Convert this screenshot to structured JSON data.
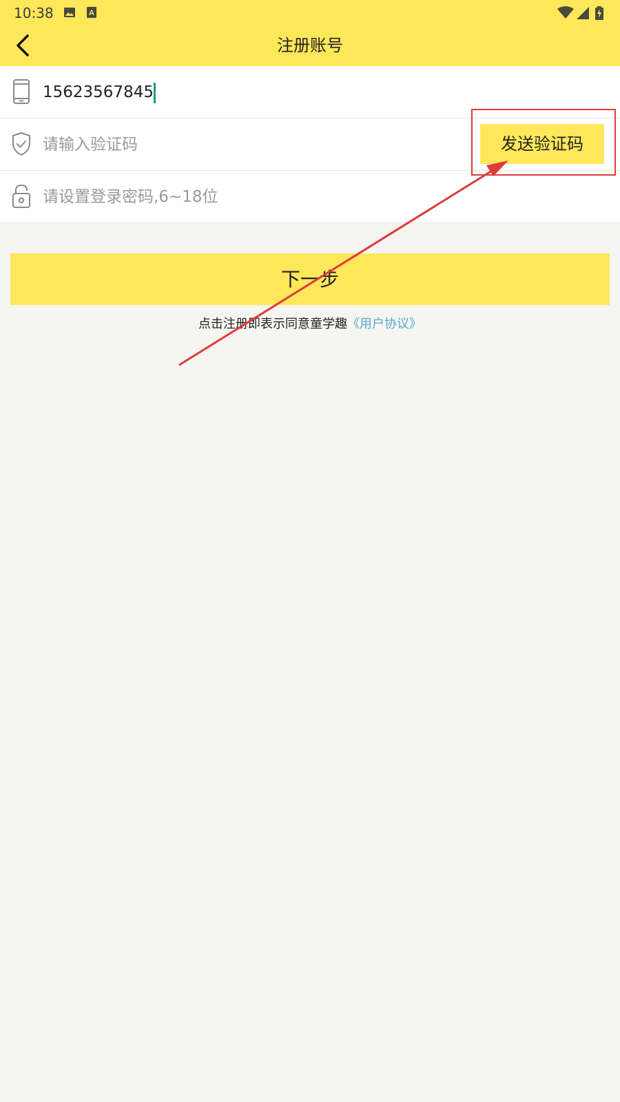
{
  "status_bar": {
    "time": "10:38",
    "icons": [
      "image-icon",
      "text-a-icon",
      "wifi-icon",
      "signal-icon",
      "battery-charging-icon"
    ]
  },
  "header": {
    "title": "注册账号",
    "back_icon": "chevron-left-icon"
  },
  "form": {
    "phone": {
      "value": "15623567845",
      "icon": "phone-icon"
    },
    "code": {
      "placeholder": "请输入验证码",
      "icon": "shield-check-icon",
      "send_label": "发送验证码"
    },
    "password": {
      "placeholder": "请设置登录密码,6~18位",
      "icon": "unlock-icon"
    }
  },
  "next_button": {
    "label": "下一步"
  },
  "agreement": {
    "text": "点击注册即表示同意童学趣",
    "link": "《用户协议》"
  },
  "colors": {
    "accent_yellow": "#ffe75a",
    "background": "#f5f5f1",
    "link": "#5aa6cf",
    "annotation_red": "#e03a3a",
    "caret": "#1a9a8c"
  }
}
